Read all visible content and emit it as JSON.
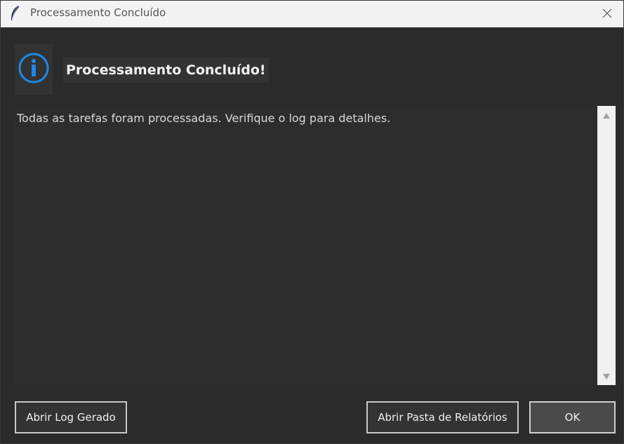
{
  "window": {
    "title": "Processamento Concluído",
    "app_icon": "feather-icon",
    "close_icon": "close-icon"
  },
  "header": {
    "icon": "info-icon",
    "icon_color": "#1e88e5",
    "title": "Processamento Concluído!"
  },
  "body": {
    "message": "Todas as tarefas foram processadas. Verifique o log para detalhes."
  },
  "scrollbar": {
    "up_icon": "scroll-up-arrow-icon",
    "down_icon": "scroll-down-arrow-icon"
  },
  "buttons": {
    "open_log": "Abrir Log Gerado",
    "open_reports_folder": "Abrir Pasta de Relatórios",
    "ok": "OK"
  },
  "colors": {
    "background": "#2b2b2b",
    "titlebar": "#f3f3f3",
    "text": "#d8d8d8"
  }
}
